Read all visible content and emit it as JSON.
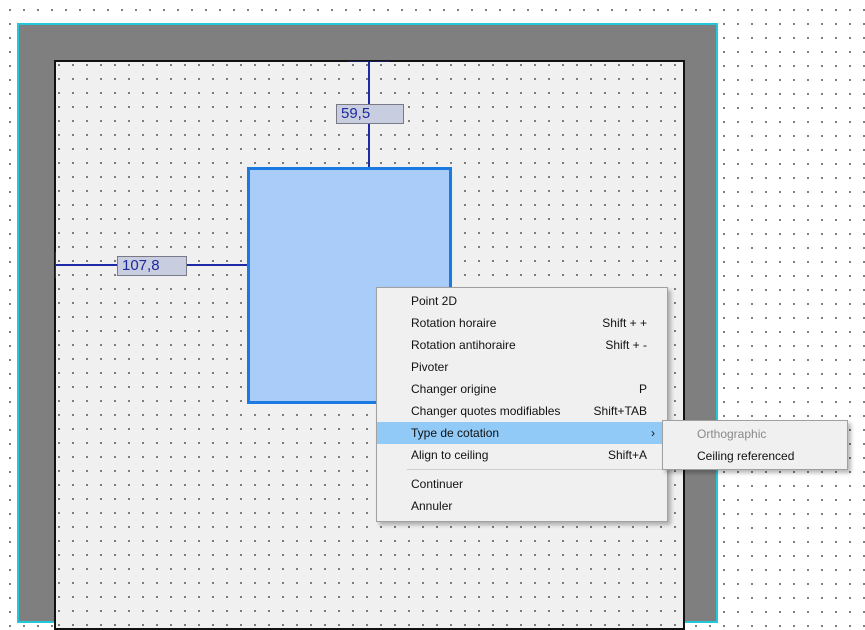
{
  "dimensions": {
    "vertical_value": "59,5",
    "horizontal_value": "107,8"
  },
  "context_menu": {
    "items": [
      {
        "label": "Point 2D",
        "shortcut": ""
      },
      {
        "label": "Rotation horaire",
        "shortcut": "Shift + +"
      },
      {
        "label": "Rotation antihoraire",
        "shortcut": "Shift + -"
      },
      {
        "label": "Pivoter",
        "shortcut": ""
      },
      {
        "label": "Changer origine",
        "shortcut": "P"
      },
      {
        "label": "Changer quotes modifiables",
        "shortcut": "Shift+TAB"
      },
      {
        "label": "Type de cotation",
        "shortcut": "",
        "has_submenu": true,
        "highlighted": true
      },
      {
        "label": "Align to ceiling",
        "shortcut": "Shift+A"
      }
    ],
    "footer_items": [
      {
        "label": "Continuer"
      },
      {
        "label": "Annuler"
      }
    ]
  },
  "submenu": {
    "items": [
      {
        "label": "Orthographic",
        "disabled": true
      },
      {
        "label": "Ceiling referenced",
        "disabled": false
      }
    ]
  },
  "colors": {
    "wall": "#7f7f7f",
    "wall_border": "#22c8d8",
    "selection_fill": "#a9cdf8",
    "selection_border": "#1a7ae0",
    "dimension_line": "#1c2aa8",
    "menu_highlight": "#91c9f7"
  }
}
